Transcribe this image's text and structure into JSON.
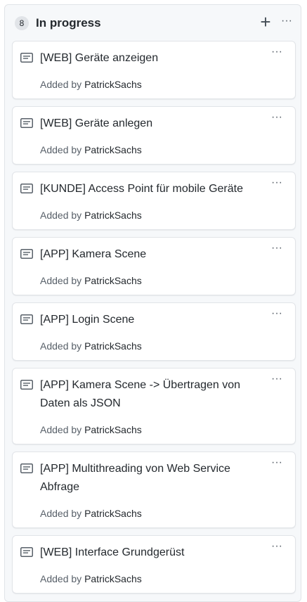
{
  "column": {
    "count": "8",
    "title": "In progress",
    "add_label": "+",
    "menu_label": "···"
  },
  "cards": [
    {
      "title": "[WEB] Geräte anzeigen",
      "added_by_label": "Added by",
      "author": "PatrickSachs",
      "menu_label": "···",
      "icon": "note-icon"
    },
    {
      "title": "[WEB] Geräte anlegen",
      "added_by_label": "Added by",
      "author": "PatrickSachs",
      "menu_label": "···",
      "icon": "note-icon"
    },
    {
      "title": "[KUNDE] Access Point für mobile Geräte",
      "added_by_label": "Added by",
      "author": "PatrickSachs",
      "menu_label": "···",
      "icon": "note-icon"
    },
    {
      "title": "[APP] Kamera Scene",
      "added_by_label": "Added by",
      "author": "PatrickSachs",
      "menu_label": "···",
      "icon": "note-icon"
    },
    {
      "title": "[APP] Login Scene",
      "added_by_label": "Added by",
      "author": "PatrickSachs",
      "menu_label": "···",
      "icon": "note-icon"
    },
    {
      "title": "[APP] Kamera Scene -> Übertragen von Daten als JSON",
      "added_by_label": "Added by",
      "author": "PatrickSachs",
      "menu_label": "···",
      "icon": "note-icon"
    },
    {
      "title": "[APP] Multithreading von Web Service Abfrage",
      "added_by_label": "Added by",
      "author": "PatrickSachs",
      "menu_label": "···",
      "icon": "note-icon"
    },
    {
      "title": "[WEB] Interface Grundgerüst",
      "added_by_label": "Added by",
      "author": "PatrickSachs",
      "menu_label": "···",
      "icon": "note-icon"
    }
  ]
}
